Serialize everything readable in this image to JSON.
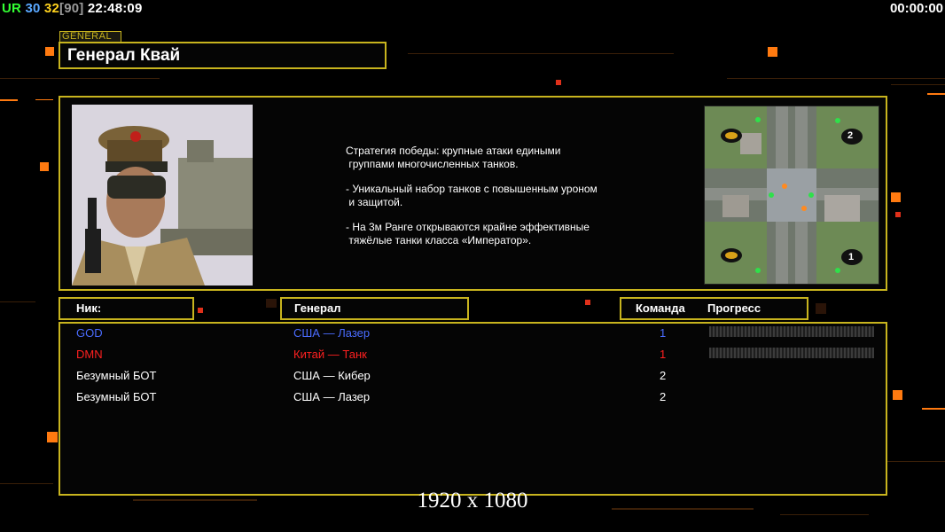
{
  "hud": {
    "ur_label": "UR",
    "ur_value_a": "30",
    "ur_value_b": "32",
    "ur_value_c": "[90]",
    "clock": "22:48:09",
    "timer": "00:00:00"
  },
  "general": {
    "tag": "GENERAL",
    "name": "Генерал Квай"
  },
  "strategy": [
    "Стратегия победы: крупные атаки едиными\n группами многочисленных танков.",
    "- Уникальный набор танков с повышенным уроном\n и защитой.",
    "- На 3м Ранге открываются крайне эффективные\n тяжёлые танки класса «Император»."
  ],
  "minimap": {
    "marker_1": "1",
    "marker_2": "2"
  },
  "table": {
    "headers": {
      "nick": "Ник:",
      "general": "Генерал",
      "team": "Команда",
      "progress": "Прогресс"
    },
    "rows": [
      {
        "nick": "GOD",
        "general": "США — Лазер",
        "team": "1",
        "color": "#4a6cff",
        "has_progress": true
      },
      {
        "nick": "DMN",
        "general": "Китай — Танк",
        "team": "1",
        "color": "#ff2020",
        "has_progress": true
      },
      {
        "nick": "Безумный БОТ",
        "general": "США — Кибер",
        "team": "2",
        "color": "#ffffff",
        "has_progress": false
      },
      {
        "nick": "Безумный БОТ",
        "general": "США — Лазер",
        "team": "2",
        "color": "#ffffff",
        "has_progress": false
      }
    ]
  },
  "footer": {
    "resolution": "1920 x 1080"
  },
  "colors": {
    "frame": "#c8b41e",
    "accent_orange": "#ff7a10"
  }
}
